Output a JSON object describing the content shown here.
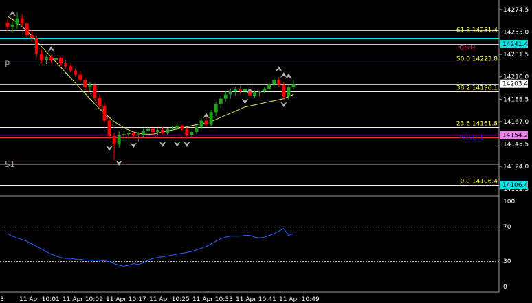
{
  "chart_data": [
    {
      "type": "candlestick",
      "panel": "price",
      "symbol_colors": {
        "bull": "#1fa21f",
        "bear": "#ff0000",
        "background": "#000000"
      },
      "price_axis": {
        "ylim": [
          14095.8,
          14283.6
        ],
        "ticks": [
          {
            "label": "14274.5",
            "value": 14274.5
          },
          {
            "label": "14253.0",
            "value": 14253.0
          },
          {
            "label": "14231.5",
            "value": 14231.5
          },
          {
            "label": "14210.0",
            "value": 14210.0
          },
          {
            "label": "14188.5",
            "value": 14188.5
          },
          {
            "label": "14167.0",
            "value": 14167.0
          },
          {
            "label": "14145.5",
            "value": 14145.5
          },
          {
            "label": "14124.0",
            "value": 14124.0
          },
          {
            "label": "14102.5",
            "value": 14102.5
          }
        ]
      },
      "time_axis": {
        "labels": [
          "3",
          "11 Apr 10:01",
          "11 Apr 10:09",
          "11 Apr 10:17",
          "11 Apr 10:25",
          "11 Apr 10:33",
          "11 Apr 10:41",
          "11 Apr 10:49"
        ]
      },
      "fib_levels": [
        {
          "label": "61.8 14251.4",
          "value": 14251.4,
          "color": "#ffff66"
        },
        {
          "label": "50.0 14223.8",
          "value": 14223.8,
          "color": "#ffff66"
        },
        {
          "label": "38.2 14196.1",
          "value": 14196.1,
          "color": "#ffff66"
        },
        {
          "label": "23.6 14161.8",
          "value": 14161.8,
          "color": "#ffff66"
        },
        {
          "label": "0.0 14106.4",
          "value": 14106.4,
          "color": "#ffff66"
        }
      ],
      "price_tags": [
        {
          "label": "14241.4",
          "value": 14241.4,
          "bg": "#00e5e5",
          "fg": "#000000"
        },
        {
          "label": "14203.4",
          "value": 14203.4,
          "bg": "#ffffff",
          "fg": "#000000"
        },
        {
          "label": "14154.2",
          "value": 14154.2,
          "bg": "#ee82ee",
          "fg": "#000000"
        },
        {
          "label": "14106.4",
          "value": 14106.4,
          "bg": "#00e5e5",
          "fg": "#000000"
        }
      ],
      "pivot_labels": [
        {
          "label": "P",
          "value": 14222.0,
          "color": "#9a9a9a"
        },
        {
          "label": "S1",
          "value": 14126.0,
          "color": "#9a9a9a"
        },
        {
          "label": "OprH",
          "value": 14238.5,
          "color": "#ff3366"
        },
        {
          "label": "PrevD_L",
          "value": 14152.0,
          "color": "#1a1aff"
        }
      ],
      "horizontal_lines": [
        {
          "value": 14254.3,
          "color": "#c8c8c8"
        },
        {
          "value": 14246.5,
          "color": "#00e5e5"
        },
        {
          "value": 14241.4,
          "color": "#c8c8c8"
        },
        {
          "value": 14238.8,
          "color": "#c8c8c8"
        },
        {
          "value": 14203.4,
          "color": "#c8c8c8"
        },
        {
          "value": 14154.2,
          "color": "#ee82ee"
        },
        {
          "value": 14151.5,
          "color": "#ff3333"
        },
        {
          "value": 14126.4,
          "color": "#cc2222"
        },
        {
          "value": 14106.4,
          "color": "#00e5e5"
        },
        {
          "value": 14101.5,
          "color": "#ffffff"
        }
      ],
      "candles": [
        [
          14262,
          14265,
          14254,
          14258
        ],
        [
          14258,
          14263,
          14252,
          14260
        ],
        [
          14260,
          14272,
          14256,
          14266
        ],
        [
          14266,
          14270,
          14258,
          14261
        ],
        [
          14261,
          14263,
          14247,
          14250
        ],
        [
          14250,
          14255,
          14244,
          14247
        ],
        [
          14247,
          14249,
          14229,
          14232
        ],
        [
          14232,
          14236,
          14223,
          14226
        ],
        [
          14226,
          14231,
          14222,
          14229
        ],
        [
          14229,
          14231,
          14224,
          14226
        ],
        [
          14226,
          14230,
          14223,
          14228
        ],
        [
          14228,
          14229,
          14221,
          14223
        ],
        [
          14223,
          14226,
          14218,
          14220
        ],
        [
          14220,
          14222,
          14214,
          14216
        ],
        [
          14216,
          14218,
          14210,
          14212
        ],
        [
          14212,
          14215,
          14205,
          14207
        ],
        [
          14207,
          14210,
          14198,
          14200
        ],
        [
          14200,
          14205,
          14196,
          14202
        ],
        [
          14202,
          14204,
          14188,
          14190
        ],
        [
          14190,
          14193,
          14180,
          14182
        ],
        [
          14182,
          14185,
          14166,
          14168
        ],
        [
          14168,
          14170,
          14150,
          14153
        ],
        [
          14153,
          14156,
          14130,
          14145
        ],
        [
          14145,
          14158,
          14142,
          14154
        ],
        [
          14154,
          14158,
          14148,
          14155
        ],
        [
          14155,
          14158,
          14150,
          14156
        ],
        [
          14156,
          14158,
          14150,
          14154
        ],
        [
          14154,
          14157,
          14148,
          14155
        ],
        [
          14155,
          14160,
          14152,
          14158
        ],
        [
          14158,
          14162,
          14155,
          14160
        ],
        [
          14160,
          14162,
          14155,
          14157
        ],
        [
          14157,
          14161,
          14154,
          14159
        ],
        [
          14159,
          14162,
          14154,
          14156
        ],
        [
          14156,
          14161,
          14154,
          14160
        ],
        [
          14160,
          14163,
          14158,
          14161
        ],
        [
          14161,
          14166,
          14159,
          14163
        ],
        [
          14163,
          14164,
          14158,
          14160
        ],
        [
          14160,
          14162,
          14150,
          14154
        ],
        [
          14154,
          14158,
          14152,
          14157
        ],
        [
          14157,
          14164,
          14155,
          14162
        ],
        [
          14162,
          14170,
          14160,
          14168
        ],
        [
          14168,
          14172,
          14162,
          14164
        ],
        [
          14164,
          14178,
          14162,
          14176
        ],
        [
          14176,
          14186,
          14172,
          14184
        ],
        [
          14184,
          14192,
          14180,
          14189
        ],
        [
          14189,
          14196,
          14186,
          14193
        ],
        [
          14193,
          14199,
          14189,
          14196
        ],
        [
          14196,
          14200,
          14192,
          14198
        ],
        [
          14198,
          14201,
          14193,
          14196
        ],
        [
          14196,
          14199,
          14192,
          14198
        ],
        [
          14198,
          14200,
          14190,
          14192
        ],
        [
          14192,
          14197,
          14190,
          14195
        ],
        [
          14195,
          14197,
          14191,
          14196
        ],
        [
          14196,
          14200,
          14194,
          14198
        ],
        [
          14198,
          14205,
          14196,
          14203
        ],
        [
          14203,
          14210,
          14200,
          14207
        ],
        [
          14207,
          14210,
          14200,
          14202
        ],
        [
          14202,
          14205,
          14188,
          14191
        ],
        [
          14191,
          14203,
          14188,
          14200
        ],
        [
          14200,
          14207,
          14198,
          14203
        ]
      ],
      "moving_average": {
        "color": "#e8e860",
        "values": [
          14268,
          14265,
          14262,
          14258,
          14254,
          14249,
          14244,
          14239,
          14234,
          14229,
          14224,
          14219,
          14214,
          14209,
          14204,
          14199,
          14194,
          14189,
          14184,
          14179,
          14175,
          14171,
          14167,
          14164,
          14161,
          14159,
          14157,
          14156,
          14155,
          14155,
          14155,
          14156,
          14157,
          14158,
          14159,
          14160,
          14161,
          14162,
          14163,
          14164,
          14165,
          14166,
          14167,
          14169,
          14171,
          14173,
          14175,
          14177,
          14179,
          14181,
          14182,
          14183,
          14184,
          14185,
          14186,
          14187,
          14188,
          14189,
          14191,
          14193
        ]
      },
      "fractal_arrows": {
        "color": "#b4b4b4",
        "up": [
          [
            1,
            14270
          ],
          [
            9,
            14236
          ],
          [
            41,
            14172
          ],
          [
            50,
            14196
          ],
          [
            56,
            14217
          ],
          [
            57,
            14211
          ],
          [
            58,
            14210
          ]
        ],
        "down": [
          [
            21,
            14142
          ],
          [
            23,
            14128
          ],
          [
            26,
            14145
          ],
          [
            32,
            14146
          ],
          [
            35,
            14146
          ],
          [
            37,
            14146
          ],
          [
            49,
            14187
          ],
          [
            57,
            14184
          ]
        ]
      },
      "zigzag": {
        "color": "#ff2222",
        "points": [
          [
            16,
            14201
          ],
          [
            22,
            14161
          ]
        ]
      }
    },
    {
      "type": "line",
      "panel": "oscillator",
      "ylim": [
        0,
        100
      ],
      "ticks": [
        {
          "label": "100",
          "value": 100
        },
        {
          "label": "70",
          "value": 70
        },
        {
          "label": "30",
          "value": 30
        },
        {
          "label": "0",
          "value": 0
        }
      ],
      "levels": [
        70,
        30
      ],
      "series": [
        {
          "color": "#2a5fff",
          "values": [
            62,
            59,
            57,
            55,
            53,
            50,
            47,
            44,
            41,
            38,
            36,
            34,
            33,
            33,
            32,
            32,
            31,
            31,
            31,
            31,
            30,
            29,
            27,
            25,
            24,
            25,
            27,
            26,
            28,
            31,
            33,
            34,
            35,
            36,
            37,
            38,
            39,
            40,
            41,
            43,
            45,
            47,
            50,
            53,
            56,
            58,
            59,
            59,
            59,
            60,
            60,
            58,
            57,
            58,
            60,
            62,
            65,
            68,
            60,
            62
          ]
        }
      ]
    }
  ]
}
